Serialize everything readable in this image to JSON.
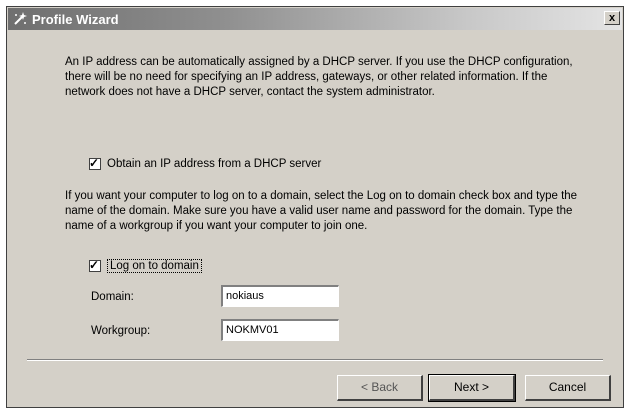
{
  "window": {
    "title": "Profile Wizard",
    "close_glyph": "x"
  },
  "icons": {
    "title_icon": "wizard-icon",
    "close_icon": "close-icon"
  },
  "content": {
    "paragraph1": "An IP address can be automatically assigned by a DHCP server. If you use the DHCP configuration, there will be no need for specifying an IP address, gateways, or other related information. If the network does not have a DHCP server, contact the system administrator.",
    "dhcp_checkbox": {
      "label": "Obtain an IP address from a DHCP server",
      "checked": true
    },
    "paragraph2": "If you want your computer to log on to a domain, select the Log on to domain check box and type the name of the domain. Make sure you have a valid user name and password for the domain. Type the name of a workgroup if you want your computer to join one.",
    "logon_checkbox": {
      "label": "Log on to domain",
      "checked": true
    },
    "domain": {
      "label": "Domain:",
      "value": "nokiaus"
    },
    "workgroup": {
      "label": "Workgroup:",
      "value": "NOKMV01"
    }
  },
  "buttons": {
    "back": "< Back",
    "next": "Next >",
    "cancel": "Cancel"
  },
  "colors": {
    "dialog_bg": "#d4d0c8",
    "titlebar_start": "#6f6f6f",
    "titlebar_end": "#e4e4e4"
  }
}
